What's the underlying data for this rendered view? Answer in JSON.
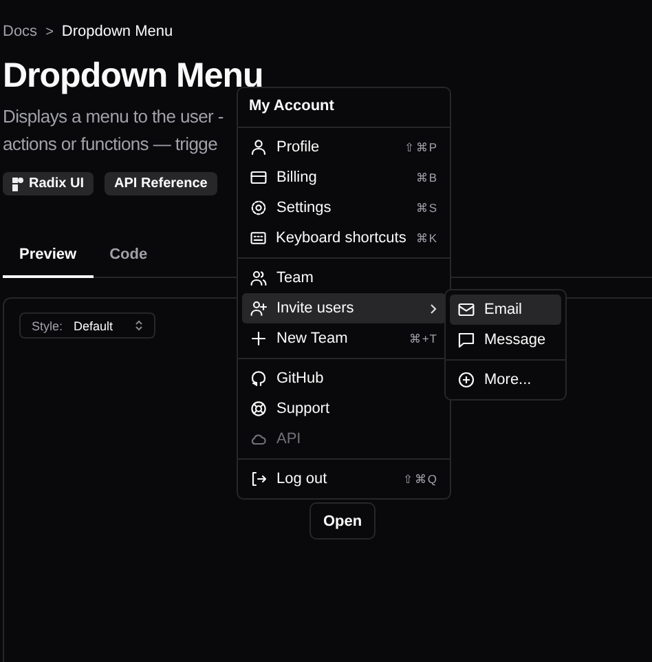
{
  "breadcrumb": {
    "parent": "Docs",
    "separator": ">",
    "current": "Dropdown Menu"
  },
  "title": "Dropdown Menu",
  "description": [
    "Displays a menu to the user -",
    "actions or functions — trigge"
  ],
  "badges": [
    {
      "label": "Radix UI",
      "kind": "icon"
    },
    {
      "label": "API Reference",
      "kind": "plain"
    }
  ],
  "tabs": [
    {
      "label": "Preview",
      "selected": true
    },
    {
      "label": "Code",
      "selected": false
    }
  ],
  "style_select": {
    "label": "Style:",
    "value": "Default"
  },
  "open_button": "Open",
  "menu": {
    "header": "My Account",
    "groups": [
      [
        {
          "label": "Profile",
          "shortcut": "⇧⌘P",
          "selected": false,
          "disabled": false,
          "submenu": false
        },
        {
          "label": "Billing",
          "shortcut": "⌘B",
          "selected": false,
          "disabled": false,
          "submenu": false
        },
        {
          "label": "Settings",
          "shortcut": "⌘S",
          "selected": false,
          "disabled": false,
          "submenu": false
        },
        {
          "label": "Keyboard shortcuts",
          "shortcut": "⌘K",
          "selected": false,
          "disabled": false,
          "submenu": false
        }
      ],
      [
        {
          "label": "Team",
          "selected": false,
          "disabled": false,
          "submenu": false
        },
        {
          "label": "Invite users",
          "selected": true,
          "disabled": false,
          "submenu": true
        },
        {
          "label": "New Team",
          "shortcut": "⌘+T",
          "selected": false,
          "disabled": false,
          "submenu": false
        }
      ],
      [
        {
          "label": "GitHub",
          "selected": false,
          "disabled": false,
          "submenu": false
        },
        {
          "label": "Support",
          "selected": false,
          "disabled": false,
          "submenu": false
        },
        {
          "label": "API",
          "selected": false,
          "disabled": true,
          "submenu": false
        }
      ],
      [
        {
          "label": "Log out",
          "shortcut": "⇧⌘Q",
          "selected": false,
          "disabled": false,
          "submenu": false
        }
      ]
    ]
  },
  "submenu": {
    "groups": [
      [
        {
          "label": "Email",
          "selected": true
        },
        {
          "label": "Message",
          "selected": false
        }
      ],
      [
        {
          "label": "More...",
          "selected": false
        }
      ]
    ]
  }
}
